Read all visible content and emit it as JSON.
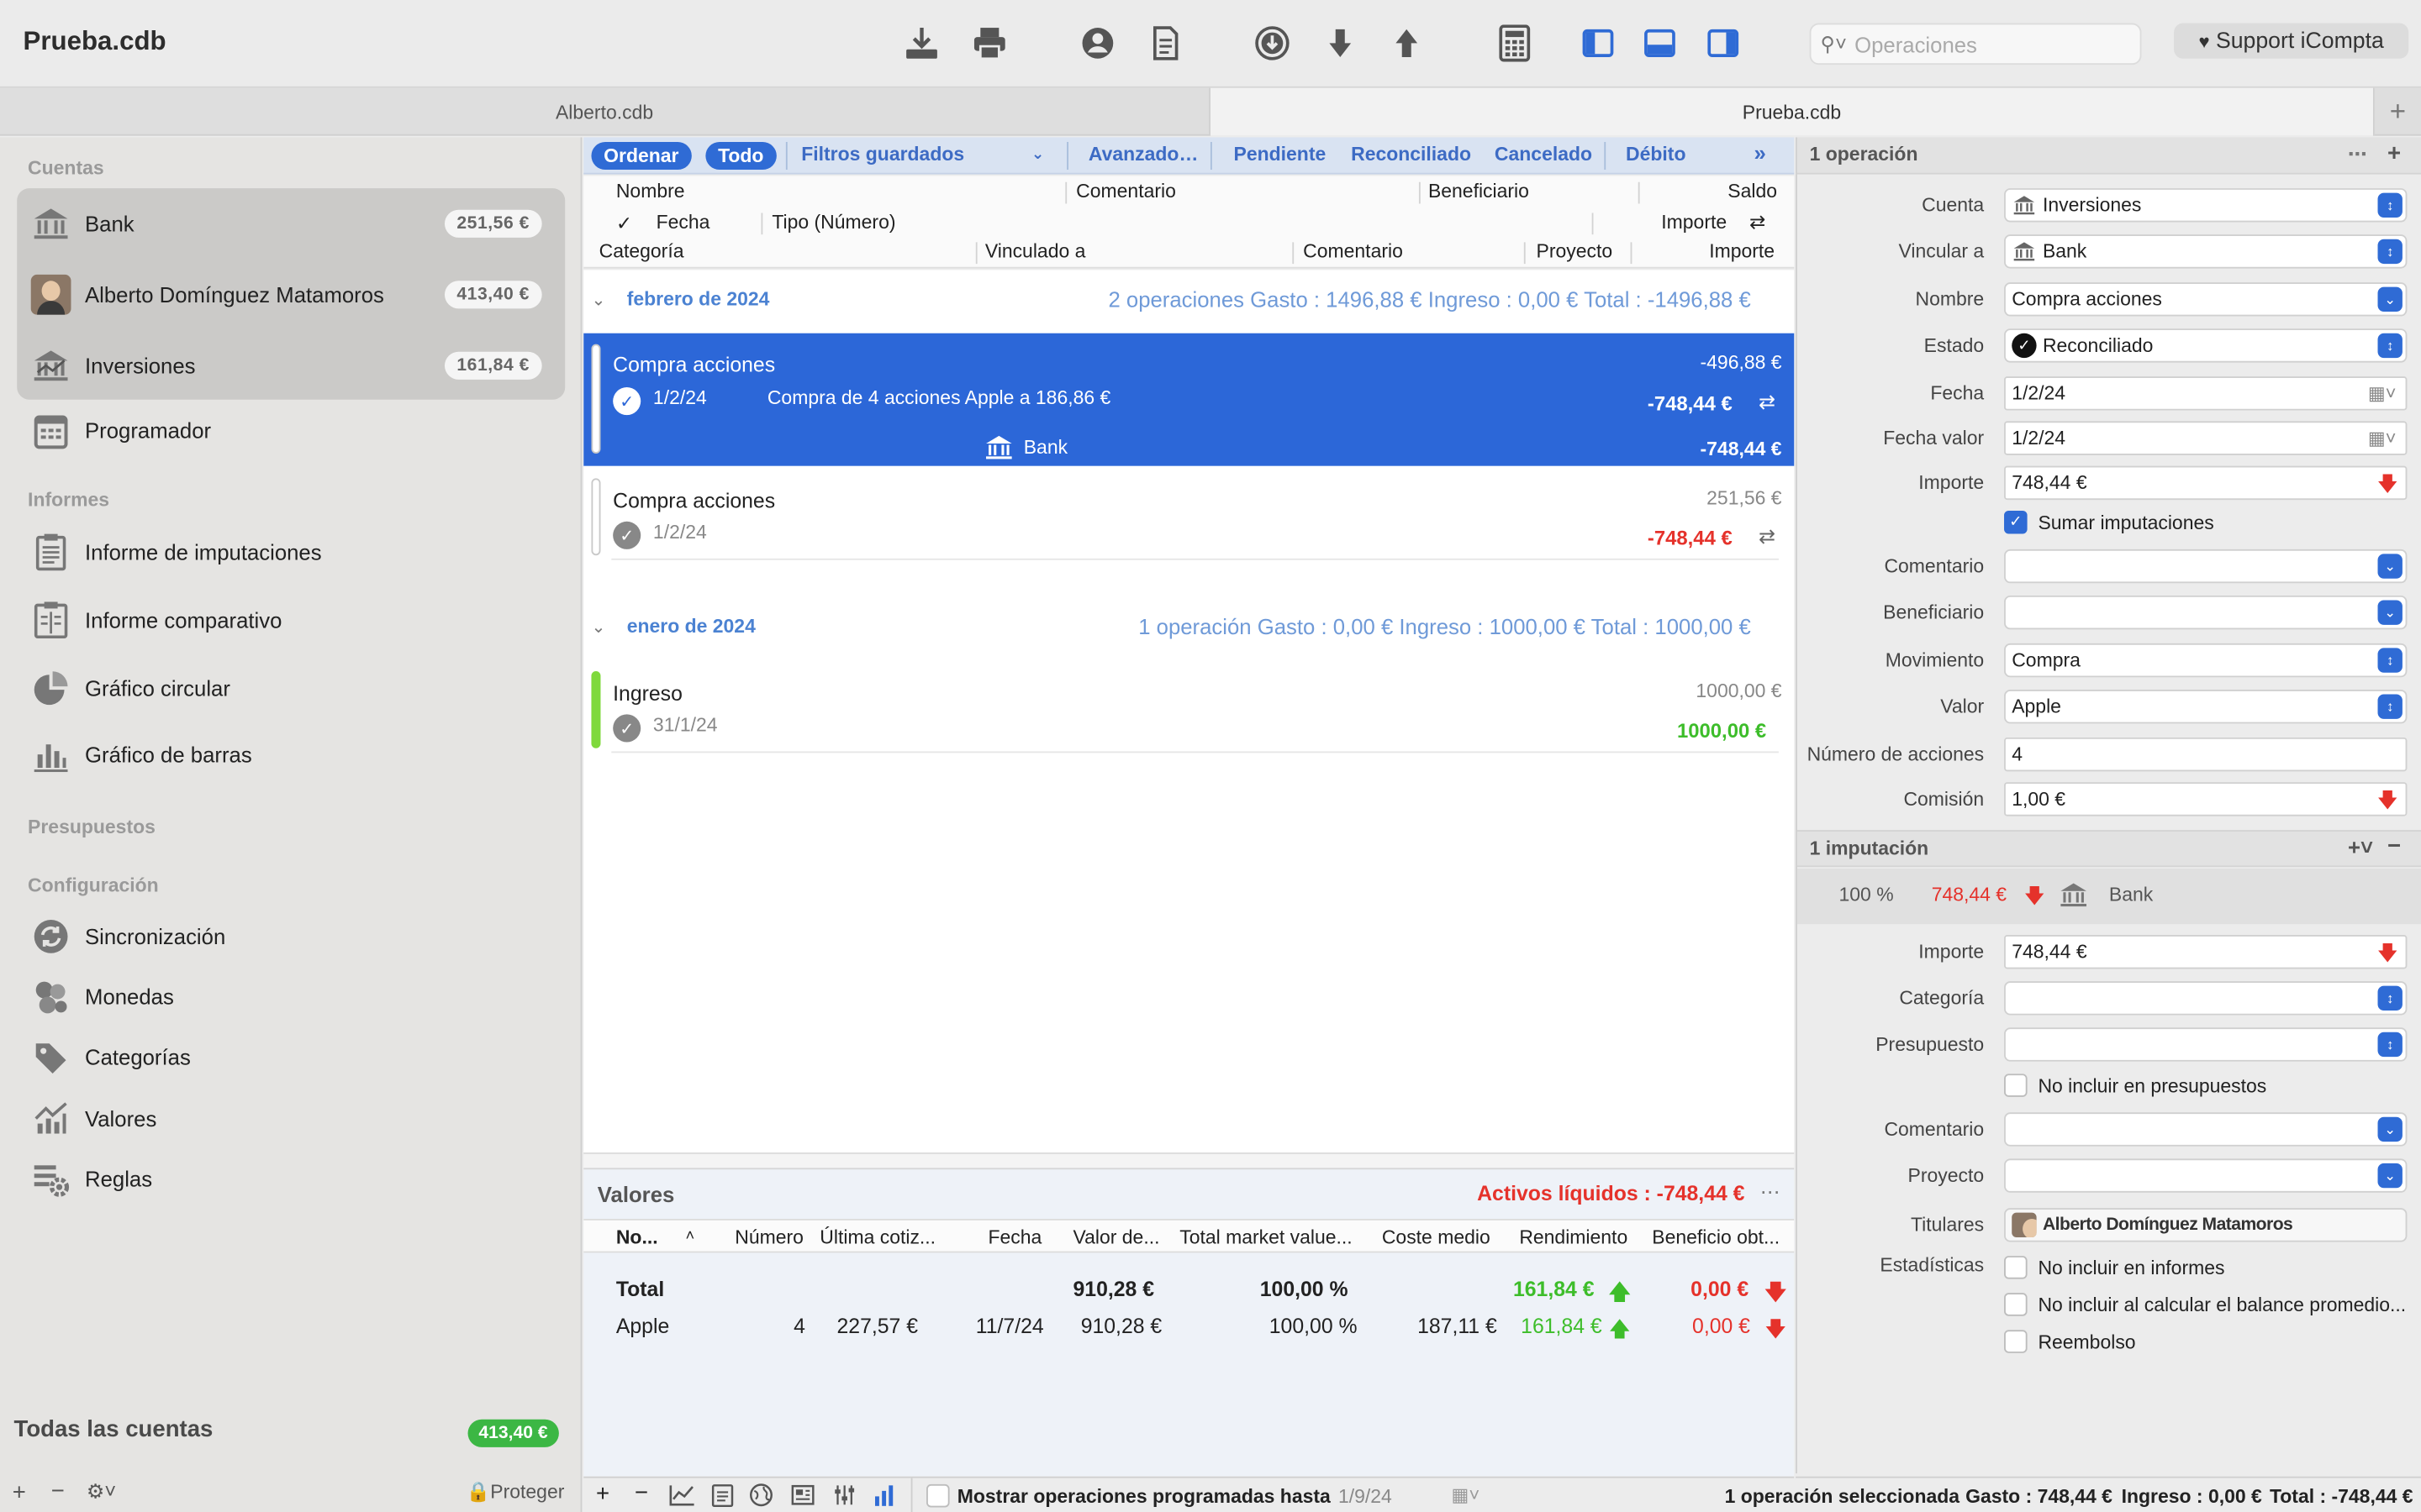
{
  "window": {
    "title": "Prueba.cdb"
  },
  "toolbar": {
    "search_placeholder": "Operaciones",
    "support_label": "Support iCompta"
  },
  "doc_tabs": [
    {
      "label": "Alberto.cdb"
    },
    {
      "label": "Prueba.cdb"
    }
  ],
  "sidebar": {
    "sections": {
      "accounts": "Cuentas",
      "reports": "Informes",
      "budgets": "Presupuestos",
      "config": "Configuración"
    },
    "accounts": [
      {
        "label": "Bank",
        "balance": "251,56 €",
        "icon": "bank-icon"
      },
      {
        "label": "Alberto Domínguez Matamoros",
        "balance": "413,40 €",
        "icon": "avatar"
      },
      {
        "label": "Inversiones",
        "balance": "161,84 €",
        "icon": "bank-icon"
      }
    ],
    "scheduler": "Programador",
    "reports": [
      "Informe de imputaciones",
      "Informe comparativo",
      "Gráfico circular",
      "Gráfico de barras"
    ],
    "config": [
      "Sincronización",
      "Monedas",
      "Categorías",
      "Valores",
      "Reglas"
    ],
    "all_accounts": {
      "label": "Todas las cuentas",
      "balance": "413,40 €"
    },
    "footer": {
      "protect": "Proteger"
    }
  },
  "filters": {
    "sort": "Ordenar",
    "all": "Todo",
    "saved": "Filtros guardados",
    "advanced": "Avanzado…",
    "pending": "Pendiente",
    "reconciled": "Reconciliado",
    "cancelled": "Cancelado",
    "debit": "Débito"
  },
  "columns": {
    "row1": [
      "Nombre",
      "Comentario",
      "Beneficiario",
      "Saldo"
    ],
    "row2": [
      "Fecha",
      "Tipo (Número)",
      "Importe"
    ],
    "row3": [
      "Categoría",
      "Vinculado a",
      "Comentario",
      "Proyecto",
      "Importe"
    ]
  },
  "groups": [
    {
      "title": "febrero de 2024",
      "summary": "2 operaciones   Gasto : 1496,88 €   Ingreso : 0,00 €   Total : -1496,88 €",
      "operations": [
        {
          "name": "Compra acciones",
          "date": "1/2/24",
          "description": "Compra de 4 acciones Apple a 186,86 €",
          "balance": "-496,88 €",
          "amount": "-748,44 €",
          "split_account": "Bank",
          "split_amount": "-748,44 €"
        },
        {
          "name": "Compra acciones",
          "date": "1/2/24",
          "balance": "251,56 €",
          "amount": "-748,44 €"
        }
      ]
    },
    {
      "title": "enero de 2024",
      "summary": "1 operación   Gasto : 0,00 €   Ingreso : 1000,00 €   Total : 1000,00 €",
      "operations": [
        {
          "name": "Ingreso",
          "date": "31/1/24",
          "balance": "1000,00 €",
          "amount": "1000,00 €"
        }
      ]
    }
  ],
  "securities": {
    "title": "Valores",
    "liquid_assets": "Activos líquidos : -748,44 €",
    "headers": [
      "No...",
      "Número",
      "Última cotiz...",
      "Fecha",
      "Valor de...",
      "Total market value...",
      "Coste medio",
      "Rendimiento",
      "Beneficio obt..."
    ],
    "total": {
      "label": "Total",
      "value": "910,28 €",
      "market": "100,00 %",
      "yield": "161,84 €",
      "profit": "0,00 €"
    },
    "rows": [
      {
        "name": "Apple",
        "number": "4",
        "last_price": "227,57 €",
        "date": "11/7/24",
        "value": "910,28 €",
        "market": "100,00 %",
        "avg_cost": "187,11 €",
        "yield": "161,84 €",
        "profit": "0,00 €"
      }
    ]
  },
  "bottom_bar": {
    "show_scheduled": "Mostrar operaciones programadas hasta",
    "scheduled_date": "1/9/24"
  },
  "inspector": {
    "header": "1 operación",
    "fields": {
      "cuenta": {
        "label": "Cuenta",
        "value": "Inversiones"
      },
      "vincular": {
        "label": "Vincular a",
        "value": "Bank"
      },
      "nombre": {
        "label": "Nombre",
        "value": "Compra acciones"
      },
      "estado": {
        "label": "Estado",
        "value": "Reconciliado"
      },
      "fecha": {
        "label": "Fecha",
        "value": "1/2/24"
      },
      "fecha_valor": {
        "label": "Fecha valor",
        "value": "1/2/24"
      },
      "importe": {
        "label": "Importe",
        "value": "748,44 €"
      },
      "sumar": "Sumar imputaciones",
      "comentario": {
        "label": "Comentario",
        "value": ""
      },
      "beneficiario": {
        "label": "Beneficiario",
        "value": ""
      },
      "movimiento": {
        "label": "Movimiento",
        "value": "Compra"
      },
      "valor": {
        "label": "Valor",
        "value": "Apple"
      },
      "num_acciones": {
        "label": "Número de acciones",
        "value": "4"
      },
      "comision": {
        "label": "Comisión",
        "value": "1,00 €"
      }
    },
    "split": {
      "header": "1 imputación",
      "percent": "100 %",
      "amount": "748,44 €",
      "account": "Bank",
      "importe": {
        "label": "Importe",
        "value": "748,44 €"
      },
      "categoria": {
        "label": "Categoría",
        "value": ""
      },
      "presupuesto": {
        "label": "Presupuesto",
        "value": ""
      },
      "no_budget": "No incluir en presupuestos",
      "comentario": {
        "label": "Comentario",
        "value": ""
      },
      "proyecto": {
        "label": "Proyecto",
        "value": ""
      },
      "titulares": {
        "label": "Titulares",
        "value": "Alberto Domínguez Matamoros"
      },
      "estadisticas": {
        "label": "Estadísticas"
      },
      "no_reports": "No incluir en informes",
      "no_avg": "No incluir al calcular el balance promedio...",
      "refund": "Reembolso"
    }
  },
  "status": {
    "selected": "1 operación seleccionada",
    "expense": "Gasto : 748,44 €",
    "income": "Ingreso : 0,00 €",
    "total": "Total : -748,44 €"
  },
  "colors": {
    "accent": "#2c67d8",
    "negative": "#e5322b",
    "positive": "#3dbd2a"
  }
}
